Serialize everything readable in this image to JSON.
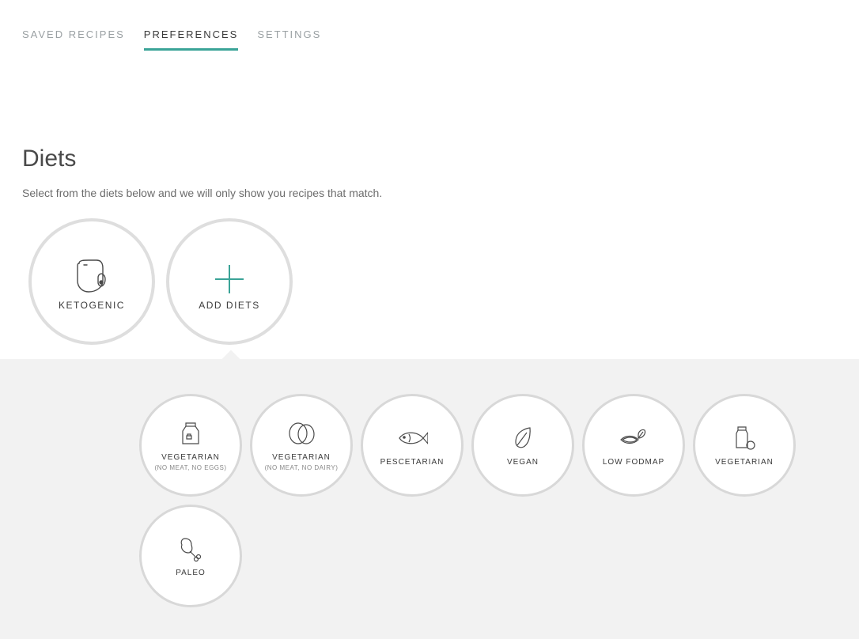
{
  "tabs": [
    {
      "label": "SAVED RECIPES",
      "active": false
    },
    {
      "label": "PREFERENCES",
      "active": true
    },
    {
      "label": "SETTINGS",
      "active": false
    }
  ],
  "section": {
    "title": "Diets",
    "subtitle": "Select from the diets below and we will only show you recipes that match."
  },
  "selected": {
    "label": "KETOGENIC"
  },
  "add": {
    "label": "ADD DIETS"
  },
  "options": [
    {
      "label": "VEGETARIAN",
      "sublabel": "(NO MEAT, NO EGGS)",
      "icon": "milk-icon"
    },
    {
      "label": "VEGETARIAN",
      "sublabel": "(NO MEAT, NO DAIRY)",
      "icon": "egg-icon"
    },
    {
      "label": "PESCETARIAN",
      "sublabel": "",
      "icon": "fish-icon"
    },
    {
      "label": "VEGAN",
      "sublabel": "",
      "icon": "leaf-icon"
    },
    {
      "label": "LOW FODMAP",
      "sublabel": "",
      "icon": "grain-icon"
    },
    {
      "label": "VEGETARIAN",
      "sublabel": "",
      "icon": "dairy-icon"
    },
    {
      "label": "PALEO",
      "sublabel": "",
      "icon": "meat-icon"
    }
  ]
}
